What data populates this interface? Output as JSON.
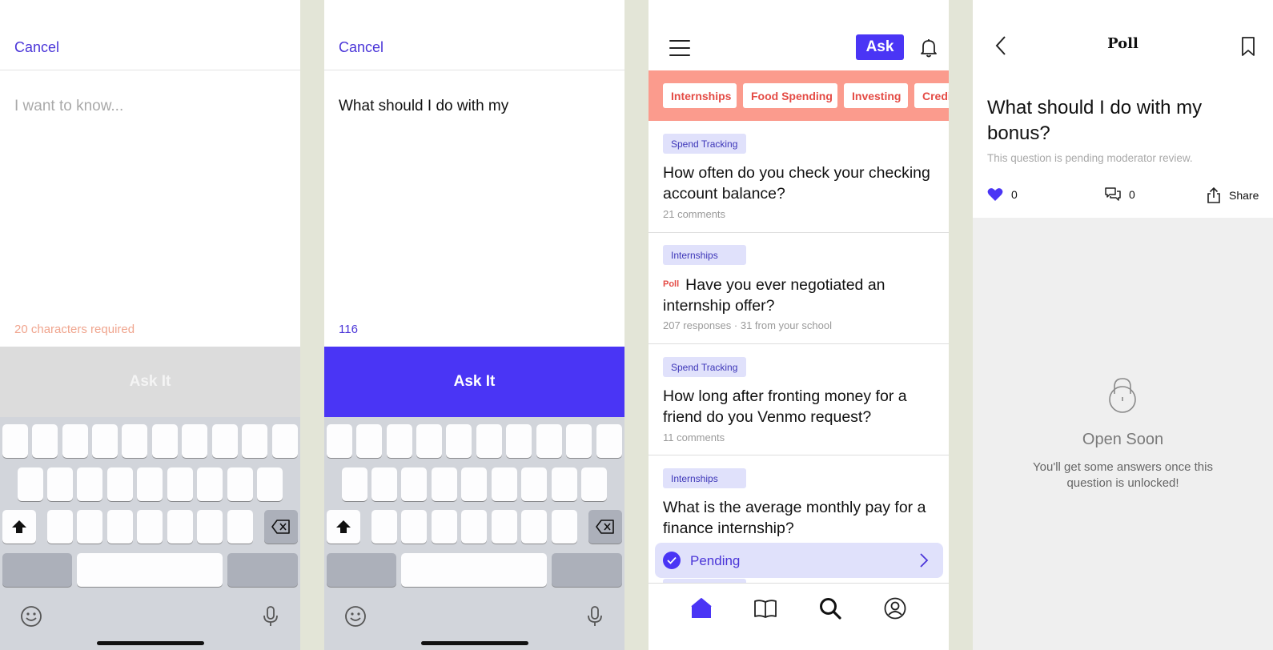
{
  "compose_empty": {
    "cancel": "Cancel",
    "placeholder": "I want to know...",
    "char_status": "20 characters required",
    "ask_it": "Ask It"
  },
  "compose_filled": {
    "cancel": "Cancel",
    "text": "What should I do with my",
    "char_status": "116",
    "ask_it": "Ask It"
  },
  "feed": {
    "ask_button": "Ask",
    "chips": [
      "Internships",
      "Food Spending",
      "Investing",
      "Credit"
    ],
    "items": [
      {
        "tag": "Spend Tracking",
        "poll": "",
        "title": "How often do you check your checking account balance?",
        "meta": "21 comments"
      },
      {
        "tag": "Internships",
        "poll": "Poll",
        "title": "Have you ever negotiated an internship offer?",
        "meta": "207 responses · 31 from your school"
      },
      {
        "tag": "Spend Tracking",
        "poll": "",
        "title": "How long after fronting money for a friend do you Venmo request?",
        "meta": "11 comments"
      },
      {
        "tag": "Internships",
        "poll": "",
        "title": "What is the average monthly pay for a finance internship?",
        "meta": ""
      }
    ],
    "pending": "Pending"
  },
  "poll_detail": {
    "header": "Poll",
    "question": "What should I do with my bonus?",
    "note": "This question is pending moderator review.",
    "likes": "0",
    "comments": "0",
    "share": "Share",
    "open_soon": "Open Soon",
    "unlock_message": "You'll get some answers once this question is unlocked!"
  },
  "colors": {
    "accent": "#4a35f5",
    "chip_bar": "#fb9b8d",
    "chip_text": "#e44b45",
    "tag_bg": "#e0e1fb"
  }
}
